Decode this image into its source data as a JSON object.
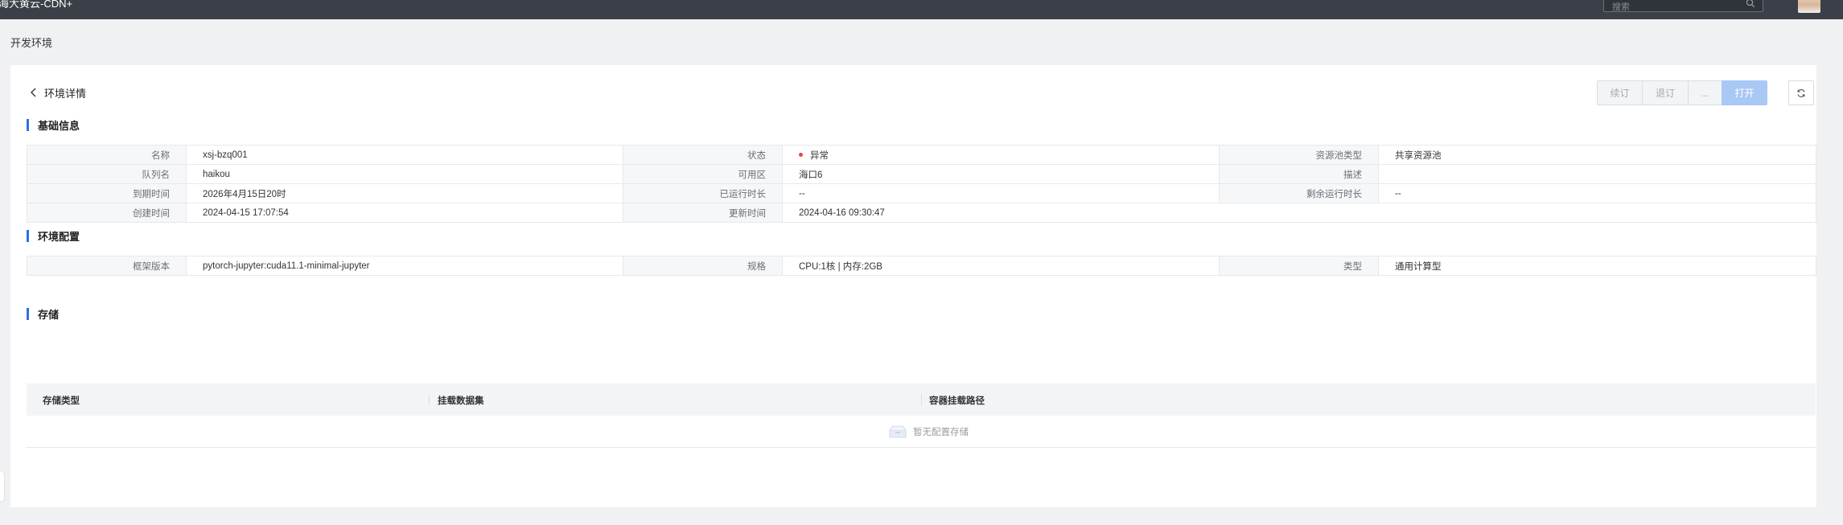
{
  "header": {
    "brand": "海大黄云-CDN+",
    "search_placeholder": "搜索"
  },
  "page": {
    "title": "开发环境"
  },
  "detail": {
    "title": "环境详情"
  },
  "actions": {
    "renew": "续订",
    "unsubscribe": "退订",
    "more": "...",
    "open": "打开"
  },
  "basic": {
    "title": "基础信息",
    "rows": [
      [
        {
          "k": "名称",
          "v": "xsj-bzq001"
        },
        {
          "k": "状态",
          "v": "异常"
        },
        {
          "k": "资源池类型",
          "v": "共享资源池"
        }
      ],
      [
        {
          "k": "队列名",
          "v": "haikou"
        },
        {
          "k": "可用区",
          "v": "海口6"
        },
        {
          "k": "描述",
          "v": ""
        }
      ],
      [
        {
          "k": "到期时间",
          "v": "2026年4月15日20时"
        },
        {
          "k": "已运行时长",
          "v": "--"
        },
        {
          "k": "剩余运行时长",
          "v": "--"
        }
      ],
      [
        {
          "k": "创建时间",
          "v": "2024-04-15 17:07:54"
        },
        {
          "k": "更新时间",
          "v": "2024-04-16 09:30:47"
        }
      ]
    ]
  },
  "env": {
    "title": "环境配置",
    "rows": [
      [
        {
          "k": "框架版本",
          "v": "pytorch-jupyter:cuda11.1-minimal-jupyter"
        },
        {
          "k": "规格",
          "v": "CPU:1核 | 内存:2GB"
        },
        {
          "k": "类型",
          "v": "通用计算型"
        }
      ]
    ]
  },
  "storage": {
    "title": "存储",
    "columns": [
      "存储类型",
      "挂载数据集",
      "容器挂载路径"
    ],
    "empty_text": "暂无配置存储"
  },
  "colors": {
    "accent": "#2f6fe4",
    "status_error": "#e5484d",
    "topbar": "#3b3f47",
    "open_button": "#a9c8f5"
  },
  "icons": [
    "search-icon",
    "back-chevron-icon",
    "refresh-icon",
    "empty-box-icon"
  ]
}
